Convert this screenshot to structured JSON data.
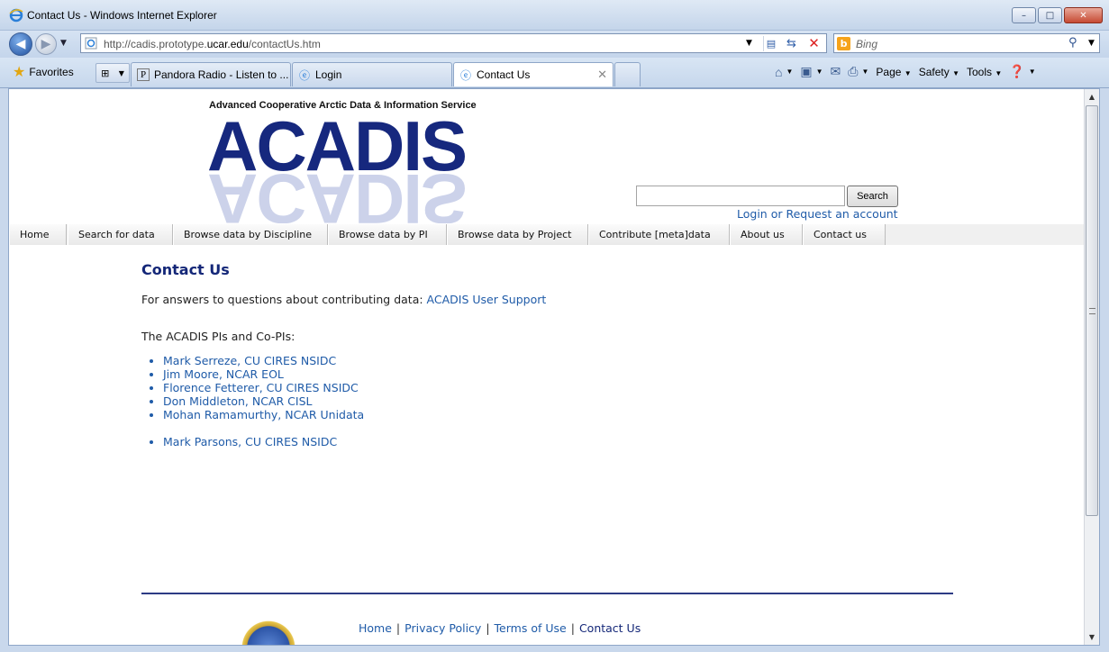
{
  "window": {
    "title": "Contact Us - Windows Internet Explorer",
    "minimize": "–",
    "maximize": "□",
    "close": "✕"
  },
  "address": {
    "url_prefix": "http://cadis.prototype.",
    "url_host": "ucar.edu",
    "url_suffix": "/contactUs.htm",
    "search_placeholder": "Bing"
  },
  "tabs": {
    "favorites_label": "Favorites",
    "items": [
      {
        "label": "Pandora Radio - Listen to ...",
        "icon": "pandora-icon"
      },
      {
        "label": "Login",
        "icon": "ie-page-icon"
      },
      {
        "label": "Contact Us",
        "icon": "ie-page-icon"
      }
    ]
  },
  "command_bar": {
    "page": "Page",
    "safety": "Safety",
    "tools": "Tools"
  },
  "site": {
    "tagline": "Advanced Cooperative Arctic Data & Information Service",
    "logo_text": "ACADIS",
    "search_button": "Search",
    "login_link": "Login or Request an account",
    "menu": [
      "Home",
      "Search for data",
      "Browse data by Discipline",
      "Browse data by PI",
      "Browse data by Project",
      "Contribute [meta]data",
      "About us",
      "Contact us"
    ]
  },
  "content": {
    "title": "Contact Us",
    "intro_text": "For answers to questions about contributing data: ",
    "intro_link": "ACADIS User Support",
    "pis_heading": "The ACADIS PIs and Co-PIs:",
    "pis": [
      "Mark Serreze, CU CIRES NSIDC",
      "Jim Moore, NCAR EOL",
      "Florence Fetterer, CU CIRES NSIDC",
      "Don Middleton, NCAR CISL",
      "Mohan Ramamurthy, NCAR Unidata",
      "Mark Parsons, CU CIRES NSIDC"
    ]
  },
  "footer": {
    "links": [
      "Home",
      "Privacy Policy",
      "Terms of Use",
      "Contact Us"
    ],
    "separator": "|"
  },
  "colors": {
    "link": "#1f5ba8",
    "title": "#142778",
    "footer_rule": "#2d3b84"
  }
}
